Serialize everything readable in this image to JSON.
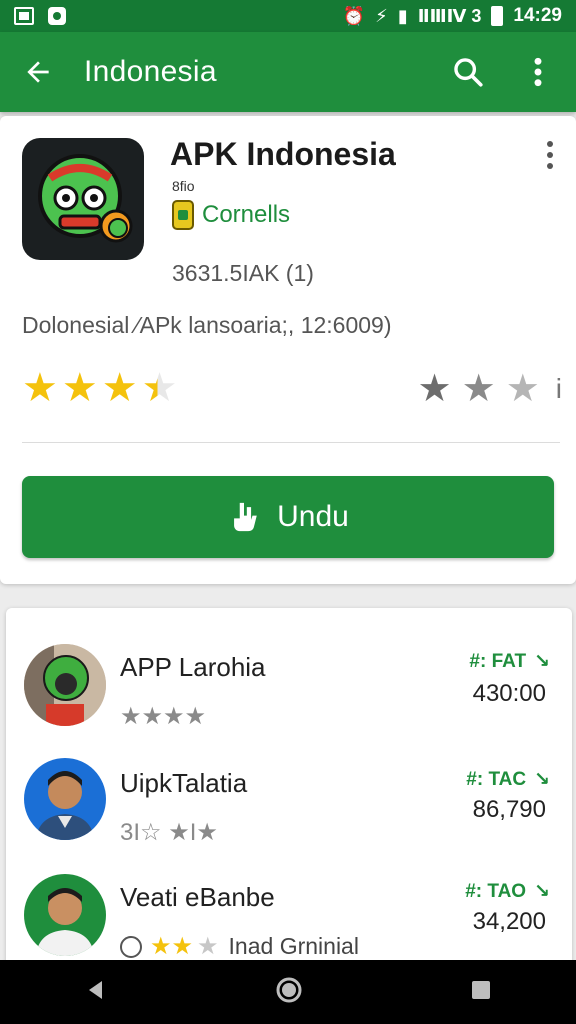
{
  "status_bar": {
    "time": "14:29",
    "signal_text": "■■■",
    "extra": "ⅡⅢⅣ 3"
  },
  "appbar": {
    "title": "Indonesia"
  },
  "app": {
    "name": "APK Indonesia",
    "sub_label": "8fio",
    "developer": "Cornells",
    "downloads": "3631.5IAK (1)",
    "description": "Dolonesial ⁄APk lansoaria;, 12:6009)",
    "rating_left": 3.5,
    "rating_right_glyphs": [
      "★",
      "★",
      "★"
    ],
    "info_glyph": "i",
    "install_label": "Undu",
    "colors": {
      "brand": "#1f8e3d",
      "star": "#f4c20d"
    }
  },
  "list": {
    "items": [
      {
        "title": "APP Larohia",
        "tag": "#: FAT",
        "tag_icon": "↘",
        "price": "430:00",
        "stars": "★★★★",
        "note": ""
      },
      {
        "title": "UipkTalatia",
        "tag": "#: TAC",
        "tag_icon": "↘",
        "price": "86,790",
        "stars": "3I☆ ★I★",
        "note": ""
      },
      {
        "title": "Veati eBanbe",
        "tag": "#: TAO",
        "tag_icon": "↘",
        "price": "34,200",
        "stars": "★★",
        "note": "Inad Grninial"
      }
    ]
  },
  "navbar": {
    "back": "back-icon",
    "home": "home-icon",
    "recents": "recents-icon"
  }
}
